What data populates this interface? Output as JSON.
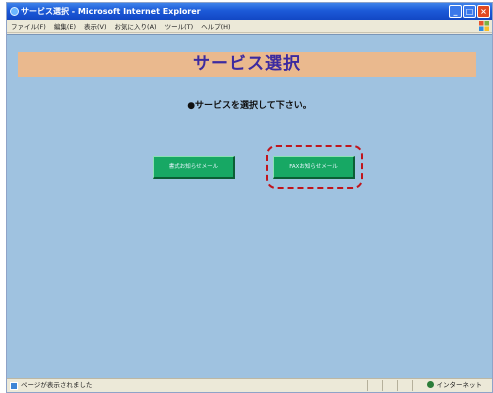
{
  "window": {
    "title": "サービス選択 - Microsoft Internet Explorer"
  },
  "menu": {
    "items": [
      "ファイル(F)",
      "編集(E)",
      "表示(V)",
      "お気に入り(A)",
      "ツール(T)",
      "ヘルプ(H)"
    ]
  },
  "page": {
    "heading": "サービス選択",
    "instruction": "●サービスを選択して下さい。",
    "buttons": {
      "left_label": "書式お知らせメール",
      "right_label": "FAXお知らせメール"
    }
  },
  "status": {
    "left_text": "ページが表示されました",
    "zone_text": "インターネット"
  },
  "colors": {
    "content_bg": "#9fc2e0",
    "banner_bg": "#eab98e",
    "button_bg": "#17a864",
    "highlight": "#c0141c"
  }
}
